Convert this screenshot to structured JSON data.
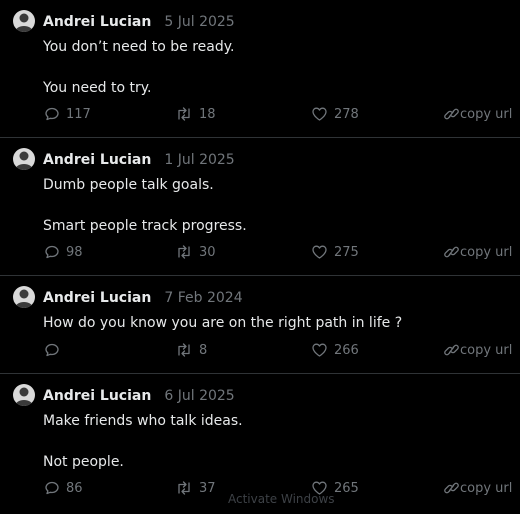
{
  "copy_label": "copy url",
  "overlay_text": "Activate Windows",
  "tweets": [
    {
      "author": "Andrei Lucian",
      "date": "5 Jul 2025",
      "lines": [
        "You don’t need to be ready.",
        "You need to try."
      ],
      "replies": "117",
      "retweets": "18",
      "likes": "278"
    },
    {
      "author": "Andrei Lucian",
      "date": "1 Jul 2025",
      "lines": [
        "Dumb people talk goals.",
        "Smart people track progress."
      ],
      "replies": "98",
      "retweets": "30",
      "likes": "275"
    },
    {
      "author": "Andrei Lucian",
      "date": "7 Feb 2024",
      "lines": [
        "How do you know you are on the right path in life ?"
      ],
      "replies": "",
      "retweets": "8",
      "likes": "266"
    },
    {
      "author": "Andrei Lucian",
      "date": "6 Jul 2025",
      "lines": [
        "Make friends who talk ideas.",
        "Not people."
      ],
      "replies": "86",
      "retweets": "37",
      "likes": "265"
    }
  ]
}
